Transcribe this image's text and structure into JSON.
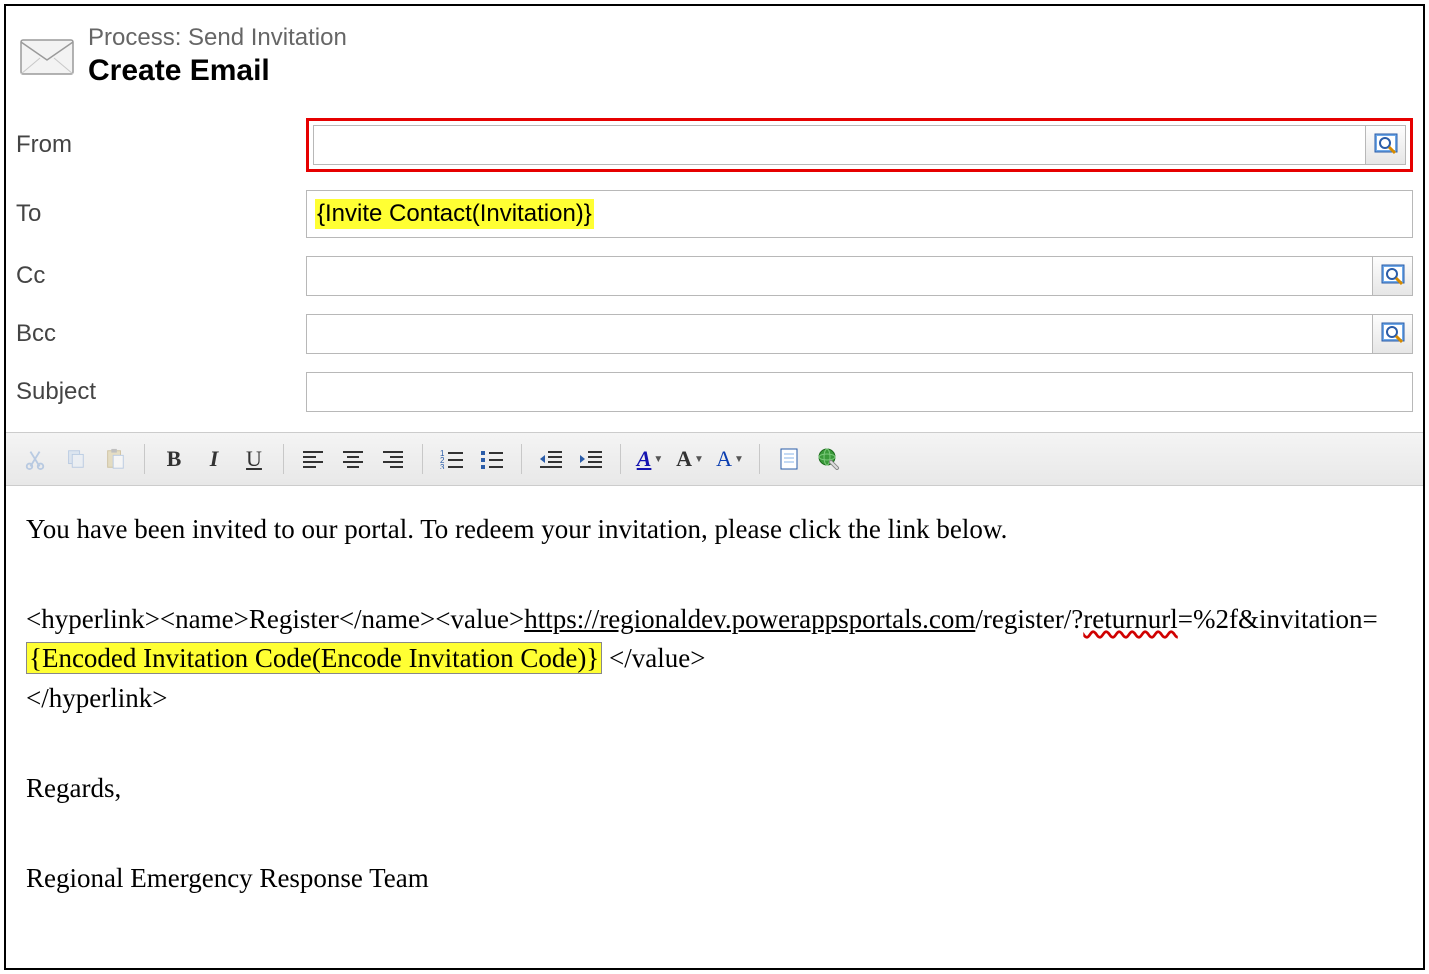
{
  "header": {
    "process_label": "Process: Send Invitation",
    "title": "Create Email"
  },
  "fields": {
    "from": {
      "label": "From",
      "value": ""
    },
    "to": {
      "label": "To",
      "token": "{Invite Contact(Invitation)}"
    },
    "cc": {
      "label": "Cc",
      "value": ""
    },
    "bcc": {
      "label": "Bcc",
      "value": ""
    },
    "subject": {
      "label": "Subject",
      "value": ""
    }
  },
  "toolbar": {
    "bold": "B",
    "italic": "I",
    "underline": "U",
    "font_color": "A",
    "font_size": "A",
    "font_face": "A"
  },
  "body": {
    "line1": "You have been invited to our portal. To redeem your invitation, please click the link below.",
    "hl_open": "<hyperlink><name>Register</name><value>",
    "url_part1": "https://regionaldev.powerappsportals.com",
    "url_part2": "/register/?",
    "url_word_return": "returnurl",
    "url_part3": "=%2f&invitation=",
    "encoded_token": "{Encoded Invitation Code(Encode Invitation Code)}",
    "hl_close_val": "  </value>",
    "hl_close": "</hyperlink>",
    "regards": "Regards,",
    "signature": "Regional Emergency Response Team"
  }
}
